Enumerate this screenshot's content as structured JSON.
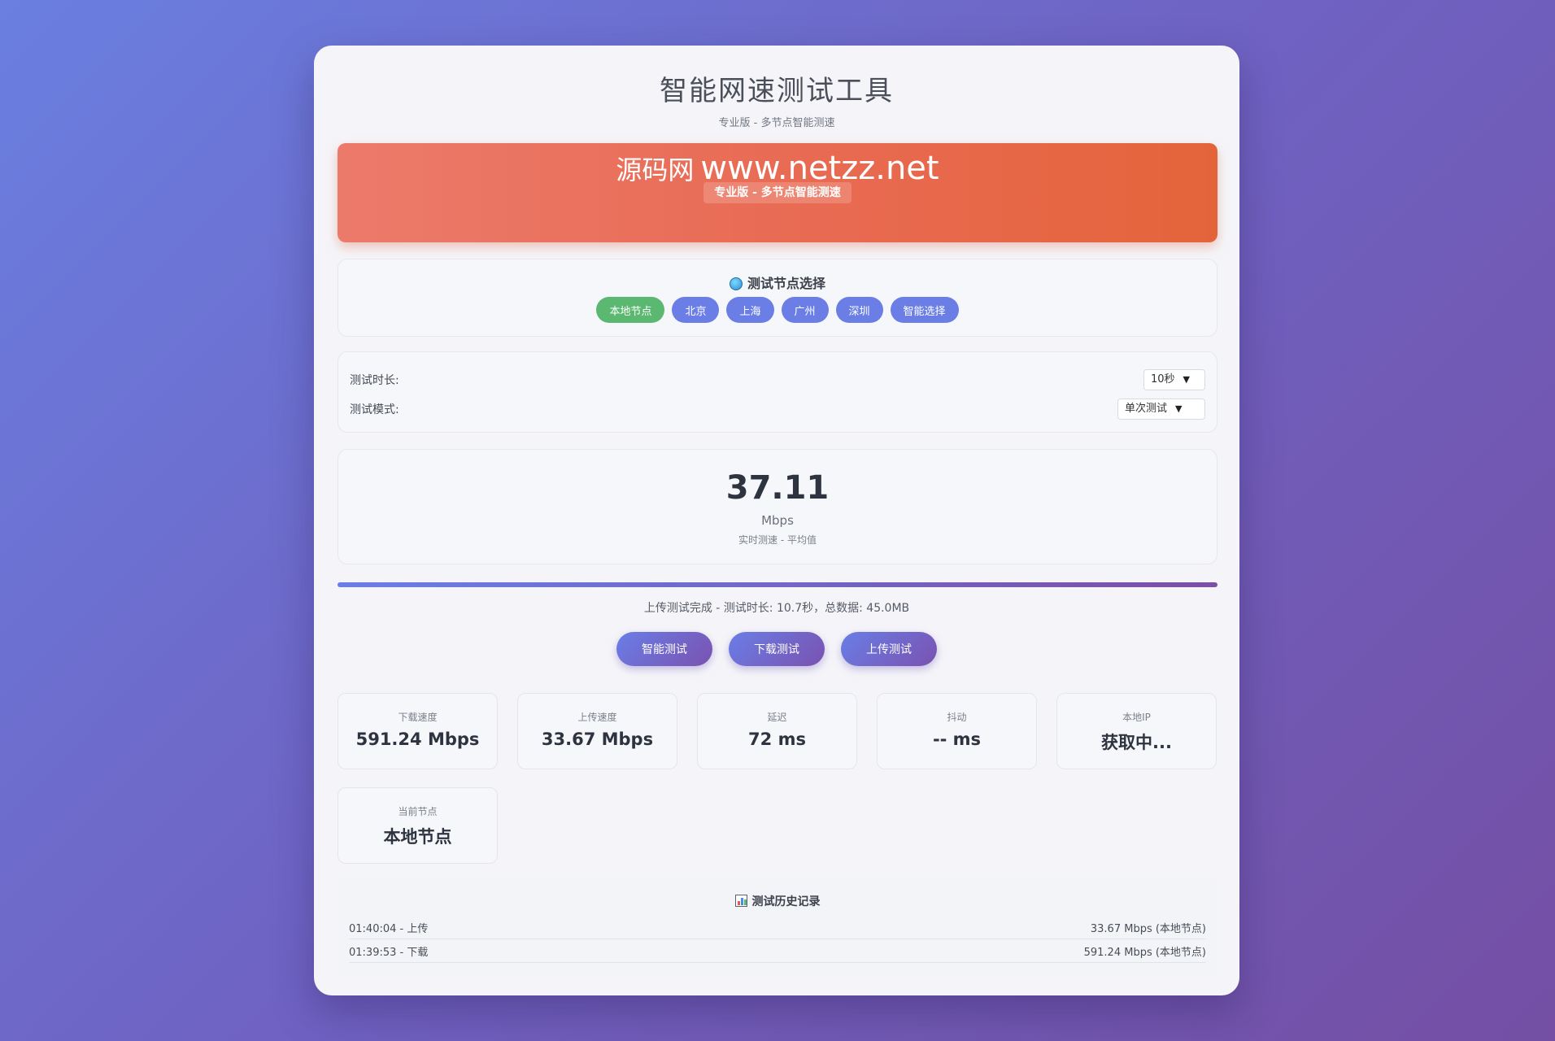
{
  "header": {
    "title": "智能网速测试工具",
    "subtitle": "专业版 - 多节点智能测速"
  },
  "banner": {
    "title_cn": "源码网",
    "title_url": "www.netzz.net",
    "badge": "专业版 - 多节点智能测速"
  },
  "nodes": {
    "title": "测试节点选择",
    "icon": "globe-icon",
    "items": [
      "本地节点",
      "北京",
      "上海",
      "广州",
      "深圳",
      "智能选择"
    ],
    "active_index": 0
  },
  "settings": {
    "duration_label": "测试时长:",
    "duration_value": "10秒",
    "mode_label": "测试模式:",
    "mode_value": "单次测试"
  },
  "speed": {
    "value": "37.11",
    "unit": "Mbps",
    "label": "实时测速 - 平均值"
  },
  "progress": {
    "percent": 100
  },
  "status": "上传测试完成 - 测试时长: 10.7秒，总数据: 45.0MB",
  "actions": {
    "smart": "智能测试",
    "download": "下载测试",
    "upload": "上传测试"
  },
  "stats": {
    "download": {
      "label": "下载速度",
      "value": "591.24 Mbps"
    },
    "upload": {
      "label": "上传速度",
      "value": "33.67 Mbps"
    },
    "latency": {
      "label": "延迟",
      "value": "72 ms"
    },
    "jitter": {
      "label": "抖动",
      "value": "-- ms"
    },
    "ip": {
      "label": "本地IP",
      "value": "获取中..."
    },
    "node": {
      "label": "当前节点",
      "value": "本地节点"
    }
  },
  "history": {
    "title": "测试历史记录",
    "icon": "bar-chart-icon",
    "rows": [
      {
        "left": "01:40:04 - 上传",
        "right": "33.67 Mbps (本地节点)"
      },
      {
        "left": "01:39:53 - 下载",
        "right": "591.24 Mbps (本地节点)"
      }
    ]
  },
  "colors": {
    "accent": "#6a7ee6",
    "active_node": "#5bb870",
    "banner": "#e86a52"
  }
}
